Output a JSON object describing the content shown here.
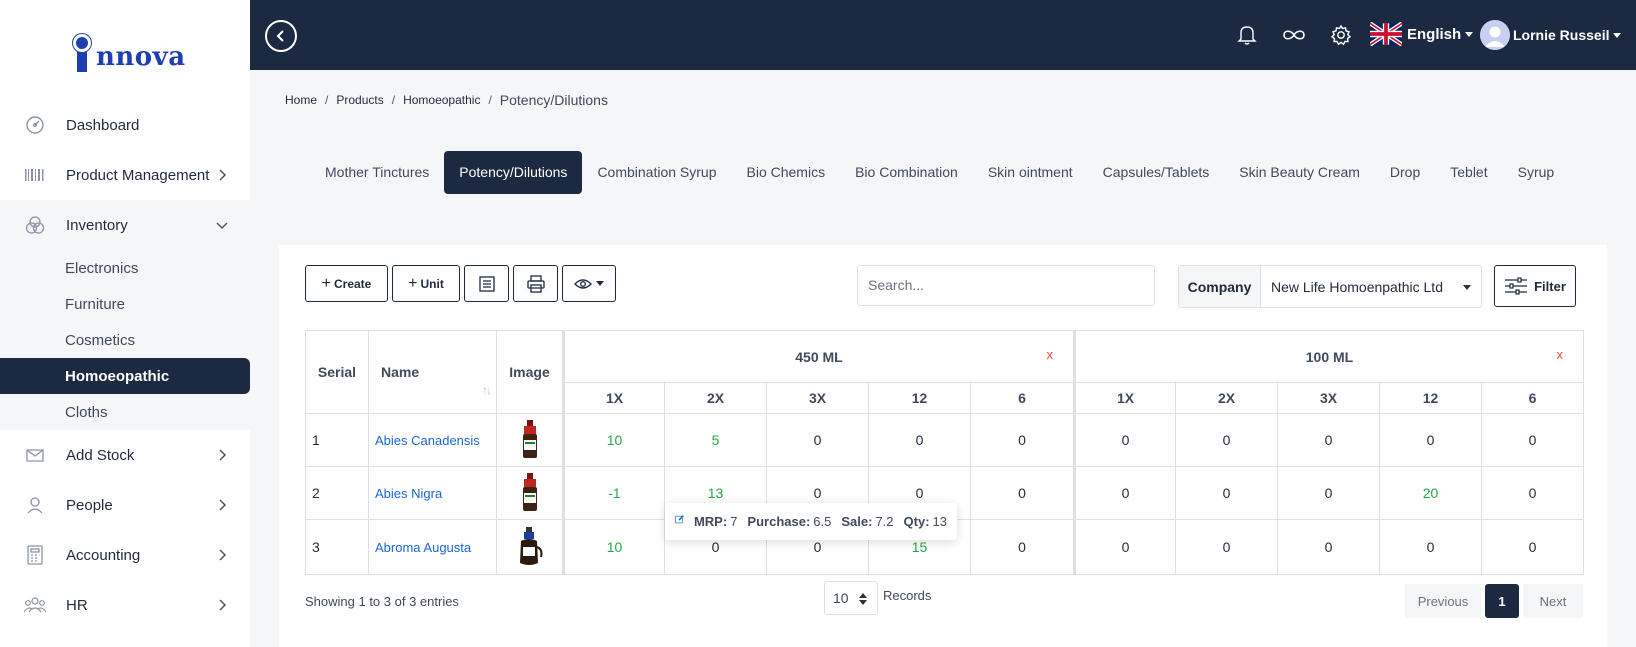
{
  "logo": {
    "text": "nnova"
  },
  "sidebar": {
    "items": [
      {
        "label": "Dashboard",
        "icon": "gauge-icon"
      },
      {
        "label": "Product Management",
        "icon": "barcode-icon"
      },
      {
        "label": "Inventory",
        "icon": "circles-icon"
      },
      {
        "label": "Add Stock",
        "icon": "inbox-icon"
      },
      {
        "label": "People",
        "icon": "person-icon"
      },
      {
        "label": "Accounting",
        "icon": "calculator-icon"
      },
      {
        "label": "HR",
        "icon": "group-icon"
      }
    ],
    "inventory_sub": [
      "Electronics",
      "Furniture",
      "Cosmetics",
      "Homoeopathic",
      "Cloths"
    ],
    "active_sub": "Homoeopathic"
  },
  "topbar": {
    "language": "English",
    "user": "Lornie Russeil"
  },
  "breadcrumb": [
    "Home",
    "Products",
    "Homoeopathic",
    "Potency/Dilutions"
  ],
  "tabs": [
    "Mother Tinctures",
    "Potency/Dilutions",
    "Combination Syrup",
    "Bio Chemics",
    "Bio Combination",
    "Skin ointment",
    "Capsules/Tablets",
    "Skin Beauty Cream",
    "Drop",
    "Teblet",
    "Syrup"
  ],
  "active_tab": "Potency/Dilutions",
  "toolbar": {
    "create_label": "Create",
    "unit_label": "Unit",
    "search_placeholder": "Search...",
    "company_label": "Company",
    "company_value": "New Life Homoenpathic Ltd",
    "filter_label": "Filter"
  },
  "table": {
    "headers": {
      "serial": "Serial",
      "name": "Name",
      "image": "Image"
    },
    "groups": [
      {
        "label": "450 ML",
        "close": "x"
      },
      {
        "label": "100 ML",
        "close": "x"
      }
    ],
    "potencies": [
      "1X",
      "2X",
      "3X",
      "12",
      "6"
    ],
    "rows": [
      {
        "serial": "1",
        "name": "Abies Canadensis",
        "g1": [
          "10",
          "5",
          "0",
          "0",
          "0"
        ],
        "g2": [
          "0",
          "0",
          "0",
          "0",
          "0"
        ]
      },
      {
        "serial": "2",
        "name": "Abies Nigra",
        "g1": [
          "-1",
          "13",
          "0",
          "0",
          "0"
        ],
        "g2": [
          "0",
          "0",
          "0",
          "20",
          "0"
        ]
      },
      {
        "serial": "3",
        "name": "Abroma Augusta",
        "g1": [
          "10",
          "0",
          "0",
          "15",
          "0"
        ],
        "g2": [
          "0",
          "0",
          "0",
          "0",
          "0"
        ]
      }
    ]
  },
  "tooltip": {
    "mrp_label": "MRP:",
    "mrp": "7",
    "purchase_label": "Purchase:",
    "purchase": "6.5",
    "sale_label": "Sale:",
    "sale": "7.2",
    "qty_label": "Qty:",
    "qty": "13"
  },
  "footer": {
    "showing": "Showing 1 to 3 of 3 entries",
    "records_value": "10",
    "records_label": "Records",
    "previous": "Previous",
    "page": "1",
    "next": "Next"
  },
  "colors": {
    "navy": "#1b2a41",
    "green": "#28a745",
    "link": "#1a66d6",
    "red": "#e74c3c"
  }
}
